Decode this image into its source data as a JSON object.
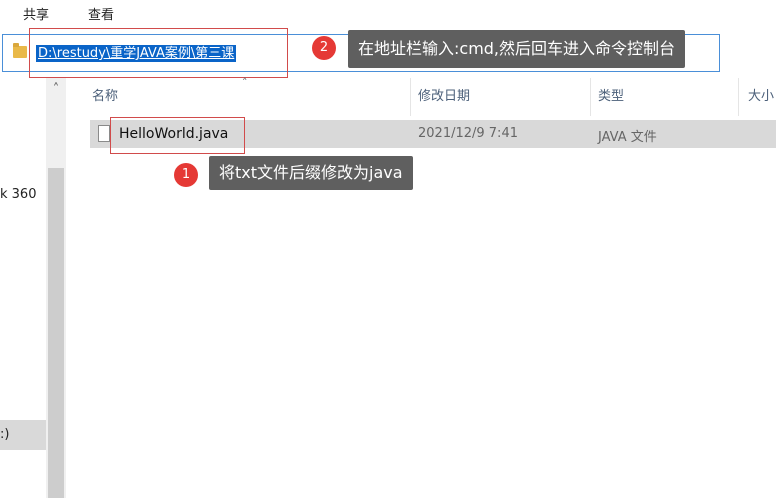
{
  "ribbon": {
    "tabs": [
      "共享",
      "查看"
    ]
  },
  "address_bar": {
    "path": "D:\\restudy\\重学JAVA案例\\第三课"
  },
  "nav_pane": {
    "item_360": "k 360",
    "item_selected": ":)"
  },
  "columns": {
    "name": "名称",
    "modified": "修改日期",
    "type": "类型",
    "size": "大小"
  },
  "files": [
    {
      "name": "HelloWorld.java",
      "modified": "2021/12/9 7:41",
      "type": "JAVA 文件"
    }
  ],
  "annotations": [
    {
      "number": "1",
      "text": "将txt文件后缀修改为java"
    },
    {
      "number": "2",
      "text": "在地址栏输入:cmd,然后回车进入命令控制台"
    }
  ],
  "colors": {
    "accent": "#0a64c8",
    "annotation_red": "#e53935",
    "callout_bg": "#5f5f5f"
  }
}
